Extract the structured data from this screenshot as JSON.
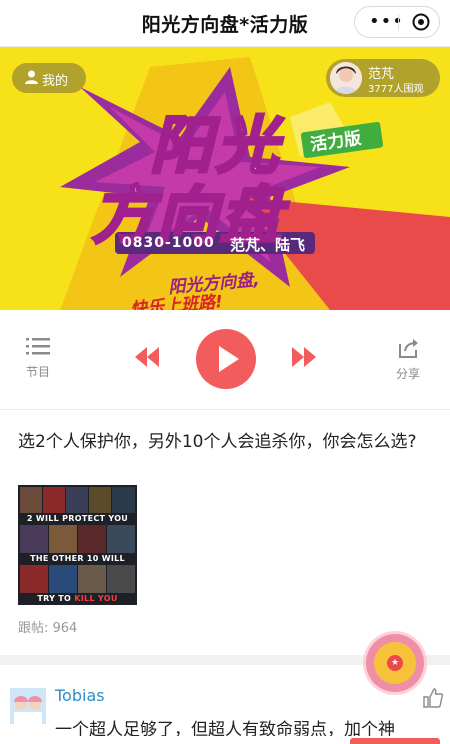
{
  "header": {
    "title": "阳光方向盘*活力版"
  },
  "banner": {
    "my_label": "我的",
    "host_name": "范芃",
    "audience": "3777人围观",
    "art_title_line1": "阳光",
    "art_title_line2": "方向盘",
    "art_badge": "活力版",
    "art_time": "0830-1000",
    "art_hosts": "范芃、陆飞",
    "art_slogan_1": "阳光方向盘,",
    "art_slogan_2": "快乐上班路!"
  },
  "controls": {
    "program_label": "节目",
    "share_label": "分享"
  },
  "post": {
    "question": "选2个人保护你，另外10个人会追杀你，你会怎么选?",
    "image_text_1": "2 WILL PROTECT YOU",
    "image_text_2": "THE OTHER 10 WILL",
    "image_text_3": "TRY TO",
    "image_text_kill": "KILL YOU",
    "follow_count": "跟帖: 964"
  },
  "comment": {
    "author": "Tobias",
    "text": "一个超人足够了，但超人有致命弱点，加个神"
  },
  "colors": {
    "accent_red": "#f25c5c",
    "banner_yellow": "#f7e21a",
    "link_blue": "#2d8ec7"
  }
}
